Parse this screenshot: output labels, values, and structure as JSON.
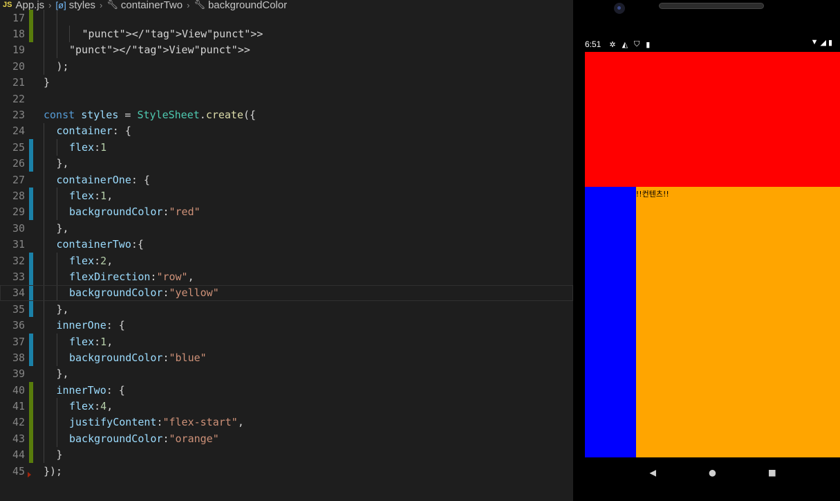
{
  "breadcrumb": {
    "badge": "JS",
    "items": [
      "App.js",
      "styles",
      "containerTwo",
      "backgroundColor"
    ]
  },
  "code_lines": [
    {
      "n": "17",
      "gutter": "add",
      "indent": 2,
      "text": ""
    },
    {
      "n": "18",
      "gutter": "add",
      "indent": 3,
      "text": "</View>"
    },
    {
      "n": "19",
      "gutter": "",
      "indent": 2,
      "text": "</View>"
    },
    {
      "n": "20",
      "gutter": "",
      "indent": 1,
      "text": ");"
    },
    {
      "n": "21",
      "gutter": "",
      "indent": 0,
      "text": "}"
    },
    {
      "n": "22",
      "gutter": "",
      "indent": 0,
      "text": ""
    },
    {
      "n": "23",
      "gutter": "",
      "indent": 0,
      "text": "const styles = StyleSheet.create({"
    },
    {
      "n": "24",
      "gutter": "",
      "indent": 1,
      "text": "container: {"
    },
    {
      "n": "25",
      "gutter": "mod",
      "indent": 2,
      "text": "flex:1"
    },
    {
      "n": "26",
      "gutter": "mod",
      "indent": 1,
      "text": "},"
    },
    {
      "n": "27",
      "gutter": "",
      "indent": 1,
      "text": "containerOne: {"
    },
    {
      "n": "28",
      "gutter": "mod",
      "indent": 2,
      "text": "flex:1,"
    },
    {
      "n": "29",
      "gutter": "mod",
      "indent": 2,
      "text": "backgroundColor:\"red\""
    },
    {
      "n": "30",
      "gutter": "",
      "indent": 1,
      "text": "},"
    },
    {
      "n": "31",
      "gutter": "",
      "indent": 1,
      "text": "containerTwo:{"
    },
    {
      "n": "32",
      "gutter": "mod",
      "indent": 2,
      "text": "flex:2,"
    },
    {
      "n": "33",
      "gutter": "mod",
      "indent": 2,
      "text": "flexDirection:\"row\","
    },
    {
      "n": "34",
      "gutter": "mod",
      "indent": 2,
      "text": "backgroundColor:\"yellow\""
    },
    {
      "n": "35",
      "gutter": "mod",
      "indent": 1,
      "text": "},"
    },
    {
      "n": "36",
      "gutter": "",
      "indent": 1,
      "text": "innerOne: {"
    },
    {
      "n": "37",
      "gutter": "mod",
      "indent": 2,
      "text": "flex:1,"
    },
    {
      "n": "38",
      "gutter": "mod",
      "indent": 2,
      "text": "backgroundColor:\"blue\""
    },
    {
      "n": "39",
      "gutter": "",
      "indent": 1,
      "text": "},"
    },
    {
      "n": "40",
      "gutter": "add",
      "indent": 1,
      "text": "innerTwo: {"
    },
    {
      "n": "41",
      "gutter": "add",
      "indent": 2,
      "text": "flex:4,"
    },
    {
      "n": "42",
      "gutter": "add",
      "indent": 2,
      "text": "justifyContent:\"flex-start\","
    },
    {
      "n": "43",
      "gutter": "add",
      "indent": 2,
      "text": "backgroundColor:\"orange\""
    },
    {
      "n": "44",
      "gutter": "add",
      "indent": 1,
      "text": "}"
    },
    {
      "n": "45",
      "gutter": "del",
      "indent": 0,
      "text": "});"
    }
  ],
  "current_line": "34",
  "phone": {
    "status": {
      "time": "6:51",
      "left_icons": [
        "gear-icon",
        "compass-icon",
        "shield-icon",
        "sd-card-icon"
      ],
      "right_icons": [
        "wifi-icon",
        "signal-icon",
        "battery-icon"
      ]
    },
    "app": {
      "container_one_color": "#ff0000",
      "inner_one_color": "#0000ff",
      "inner_two_color": "#ffa500",
      "inner_two_text": "!!컨텐츠!!"
    },
    "nav": {
      "back": "◀",
      "home": "●",
      "recents": "■"
    }
  }
}
